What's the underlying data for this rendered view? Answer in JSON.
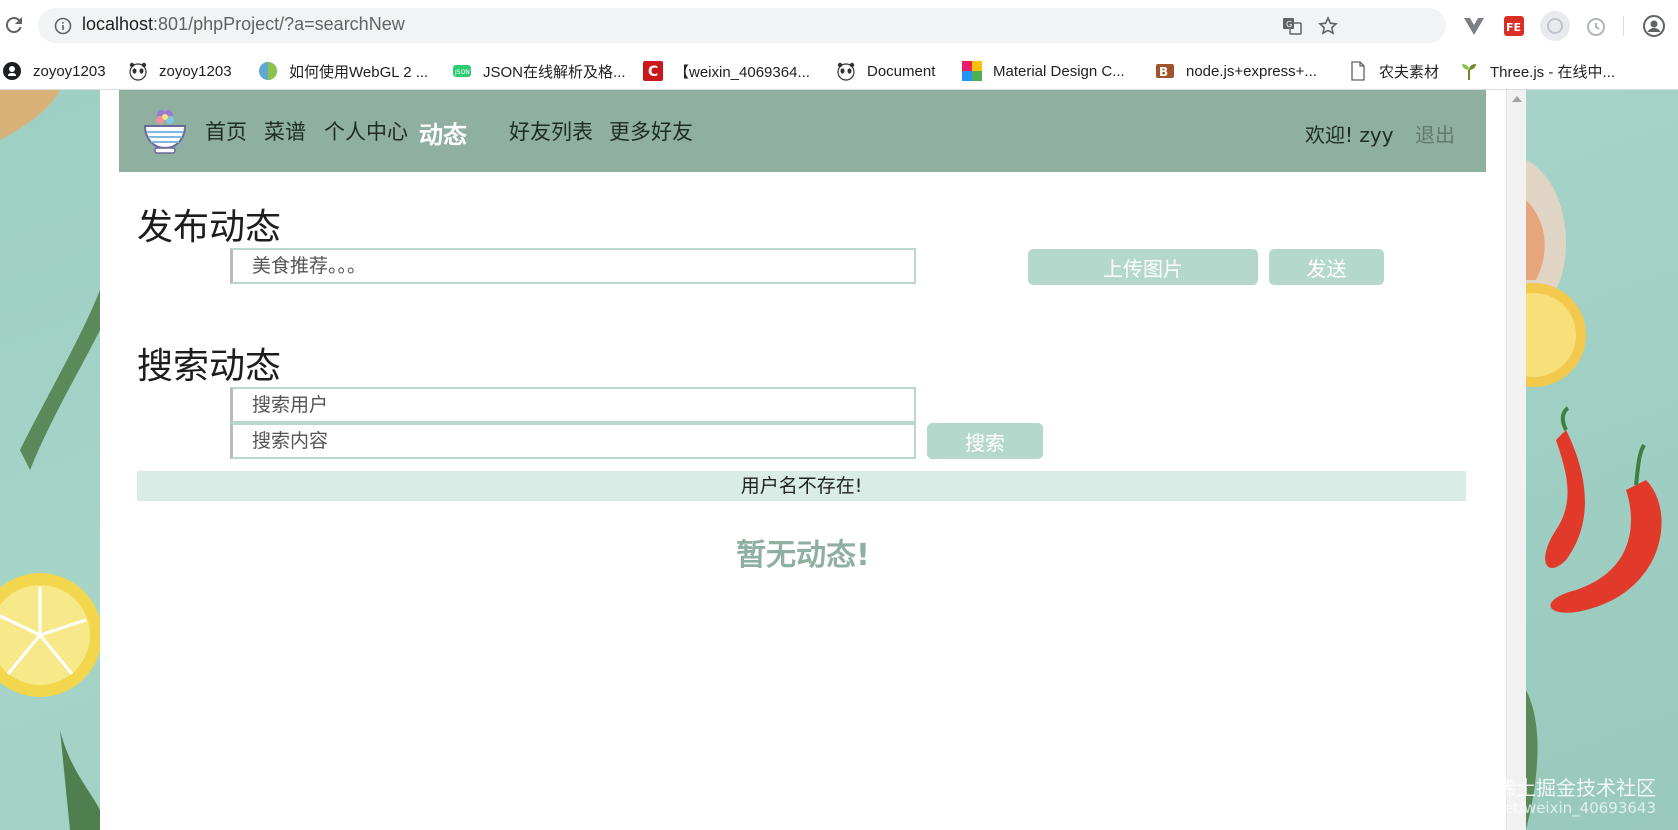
{
  "browser": {
    "url_host": "localhost",
    "url_rest": ":801/phpProject/?a=searchNew",
    "bookmarks": [
      {
        "label": "zoyoy1203",
        "icon": "github-icon"
      },
      {
        "label": "zoyoy1203",
        "icon": "panda-icon"
      },
      {
        "label": "如何使用WebGL 2 ...",
        "icon": "webgl-icon"
      },
      {
        "label": "JSON在线解析及格...",
        "icon": "json-icon"
      },
      {
        "label": "【weixin_4069364...",
        "icon": "csdn-icon"
      },
      {
        "label": "Document",
        "icon": "panda-icon"
      },
      {
        "label": "Material Design C...",
        "icon": "material-icon"
      },
      {
        "label": "node.js+express+...",
        "icon": "node-icon"
      },
      {
        "label": "农夫素材",
        "icon": "page-icon"
      },
      {
        "label": "Three.js - 在线中...",
        "icon": "plant-icon"
      }
    ]
  },
  "nav": {
    "items": [
      "首页",
      "菜谱",
      "个人中心",
      "动态",
      "好友列表",
      "更多好友"
    ],
    "active_index": 3,
    "welcome": "欢迎!  zyy",
    "logout": "退出"
  },
  "publish": {
    "heading": "发布动态",
    "placeholder": "美食推荐。。。",
    "upload_label": "上传图片",
    "send_label": "发送"
  },
  "search": {
    "heading": "搜索动态",
    "user_placeholder": "搜索用户",
    "content_placeholder": "搜索内容",
    "button_label": "搜索"
  },
  "message": "用户名不存在!",
  "empty_message": "暂无动态!",
  "watermark": {
    "line1": "@稀土掘金技术社区",
    "line2": "https://blog.csdn.net/weixin_40693643"
  },
  "colors": {
    "nav_bg": "#8fb0a1",
    "button_bg": "#b5d8cd",
    "message_bg": "#d9ece6",
    "page_bg": "#a6d4c9"
  }
}
